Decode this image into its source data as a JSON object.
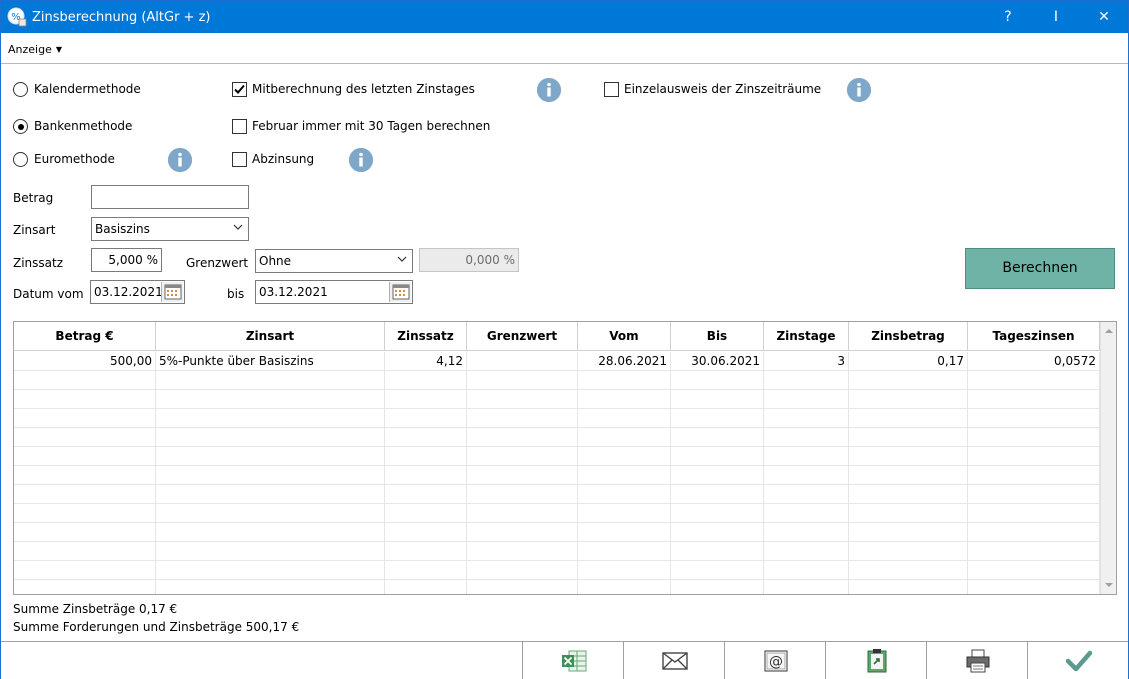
{
  "window": {
    "title": "Zinsberechnung (AltGr + z)",
    "help_label": "?",
    "pin_label": "I",
    "close_label": "✕"
  },
  "menu": {
    "anzeige": "Anzeige"
  },
  "options": {
    "method_radios": [
      {
        "label": "Kalendermethode",
        "selected": false
      },
      {
        "label": "Bankenmethode",
        "selected": true
      },
      {
        "label": "Euromethode",
        "selected": false
      }
    ],
    "mitberechnung": {
      "label": "Mitberechnung des letzten Zinstages",
      "checked": true
    },
    "februar": {
      "label": "Februar immer mit 30 Tagen berechnen",
      "checked": false
    },
    "abzinsung": {
      "label": "Abzinsung",
      "checked": false
    },
    "einzelausweis": {
      "label": "Einzelausweis der Zinszeiträume",
      "checked": false
    }
  },
  "form": {
    "betrag_label": "Betrag",
    "betrag_value": "",
    "zinsart_label": "Zinsart",
    "zinsart_value": "Basiszins",
    "zinssatz_label": "Zinssatz",
    "zinssatz_value": "5,000 %",
    "grenzwert_label": "Grenzwert",
    "grenzwert_select": "Ohne",
    "grenzwert_value": "0,000 %",
    "datum_vom_label": "Datum vom",
    "datum_vom_value": "03.12.2021",
    "bis_label": "bis",
    "bis_value": "03.12.2021"
  },
  "berechnen_label": "Berechnen",
  "table": {
    "columns": [
      "Betrag €",
      "Zinsart",
      "Zinssatz",
      "Grenzwert",
      "Vom",
      "Bis",
      "Zinstage",
      "Zinsbetrag",
      "Tageszinsen"
    ],
    "rows": [
      [
        "500,00",
        "5%-Punkte über Basiszins",
        "4,12",
        "",
        "28.06.2021",
        "30.06.2021",
        "3",
        "0,17",
        "0,0572"
      ]
    ]
  },
  "summary": {
    "zinsbetraege": "Summe Zinsbeträge 0,17 €",
    "forderungen": "Summe Forderungen und Zinsbeträge 500,17 €"
  },
  "footer_icons": [
    "excel-export-icon",
    "mail-icon",
    "email-e-icon",
    "clipboard-icon",
    "printer-icon",
    "checkmark-icon"
  ],
  "colors": {
    "titlebar": "#0078d7",
    "berechnen": "#6fb3a6",
    "info_icon": "#7fa7c9",
    "check_ok": "#5a9a8f"
  }
}
